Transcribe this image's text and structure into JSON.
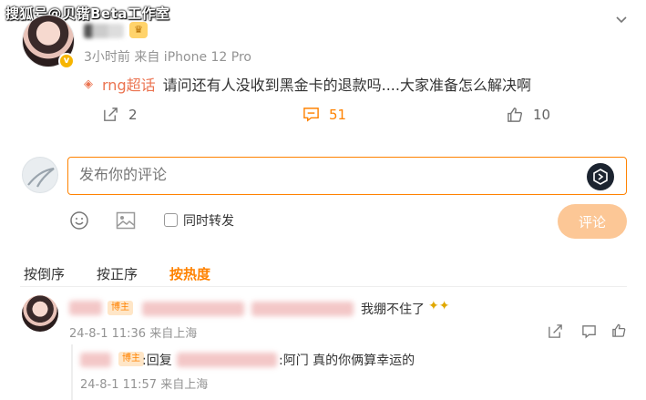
{
  "watermark": "搜狐号@贝锴Beta工作室",
  "post": {
    "meta": "3小时前 来自 iPhone 12 Pro",
    "topic": "rng超话",
    "text": "请问还有人没收到黑金卡的退款吗....大家准备怎么解决啊",
    "repost_count": "2",
    "comment_count": "51",
    "like_count": "10"
  },
  "composer": {
    "placeholder": "发布你的评论",
    "repost_label": "同时转发",
    "submit_label": "评论"
  },
  "sort_tabs": [
    "按倒序",
    "按正序",
    "按热度"
  ],
  "comments": [
    {
      "badge": "博主",
      "text": "我绷不住了",
      "meta": "24-8-1 11:36 来自上海"
    }
  ],
  "reply": {
    "badge": "博主",
    "prefix": ":回复",
    "text": ":阿门 真的你俩算幸运的",
    "meta": "24-8-1 11:57 来自上海"
  },
  "colors": {
    "accent": "#ff8200",
    "topic": "#eb7350",
    "muted": "#939393"
  }
}
